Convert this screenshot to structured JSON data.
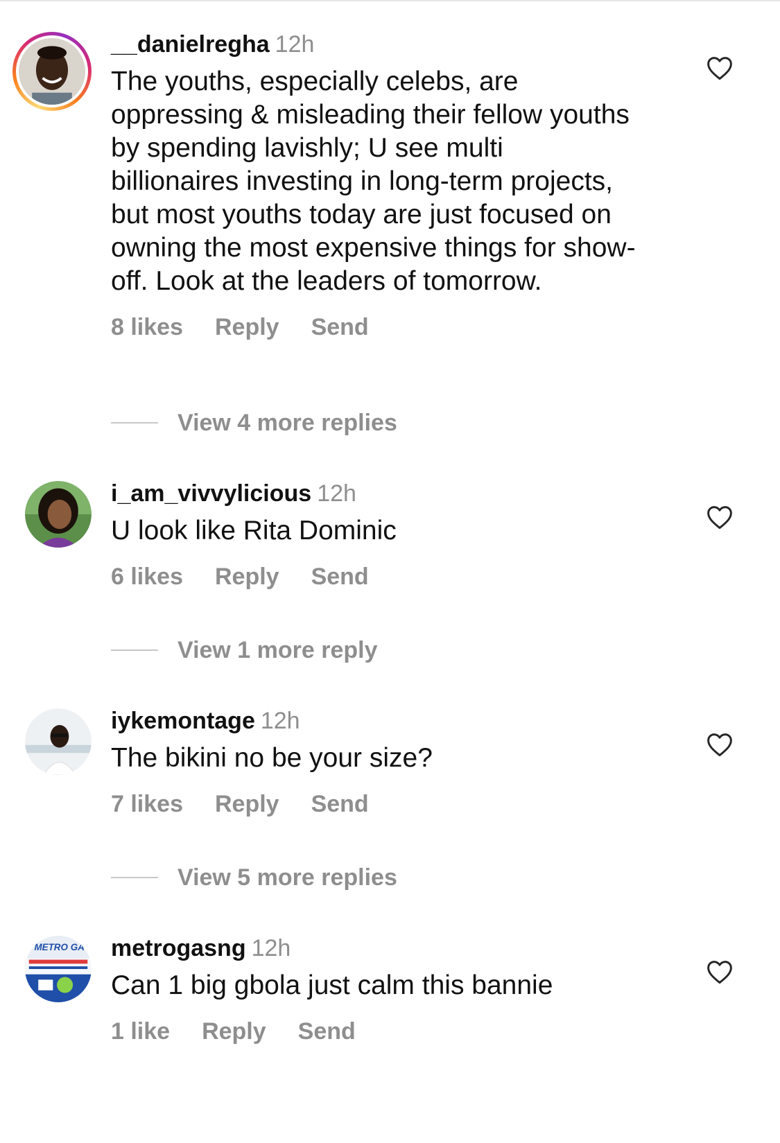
{
  "comments": [
    {
      "username": "__danielregha",
      "time": "12h",
      "text": "The youths, especially celebs, are oppressing & misleading their fellow youths by spending lavishly; U see multi billionaires investing in long-term projects, but most youths today are just focused on owning the most expensive things for show-off. Look at the leaders of tomorrow.",
      "likes": "8 likes",
      "reply": "Reply",
      "send": "Send",
      "view_replies": "View 4 more replies",
      "has_story": true
    },
    {
      "username": "i_am_vivvylicious",
      "time": "12h",
      "text": "U look like Rita Dominic",
      "likes": "6 likes",
      "reply": "Reply",
      "send": "Send",
      "view_replies": "View 1 more reply",
      "has_story": false
    },
    {
      "username": "iykemontage",
      "time": "12h",
      "text": "The bikini no be your size?",
      "likes": "7 likes",
      "reply": "Reply",
      "send": "Send",
      "view_replies": "View 5 more replies",
      "has_story": false
    },
    {
      "username": "metrogasng",
      "time": "12h",
      "text": "Can 1 big gbola just calm this bannie",
      "likes": "1 like",
      "reply": "Reply",
      "send": "Send",
      "view_replies": "",
      "has_story": false,
      "avatar_logo_text": "METRO GA"
    }
  ],
  "colors": {
    "primary_text": "#111111",
    "secondary_text": "#8e8e8e",
    "story_ring": [
      "#feda75",
      "#fa7e1e",
      "#d62976",
      "#962fbf"
    ]
  },
  "icons": [
    "heart-outline-icon"
  ]
}
